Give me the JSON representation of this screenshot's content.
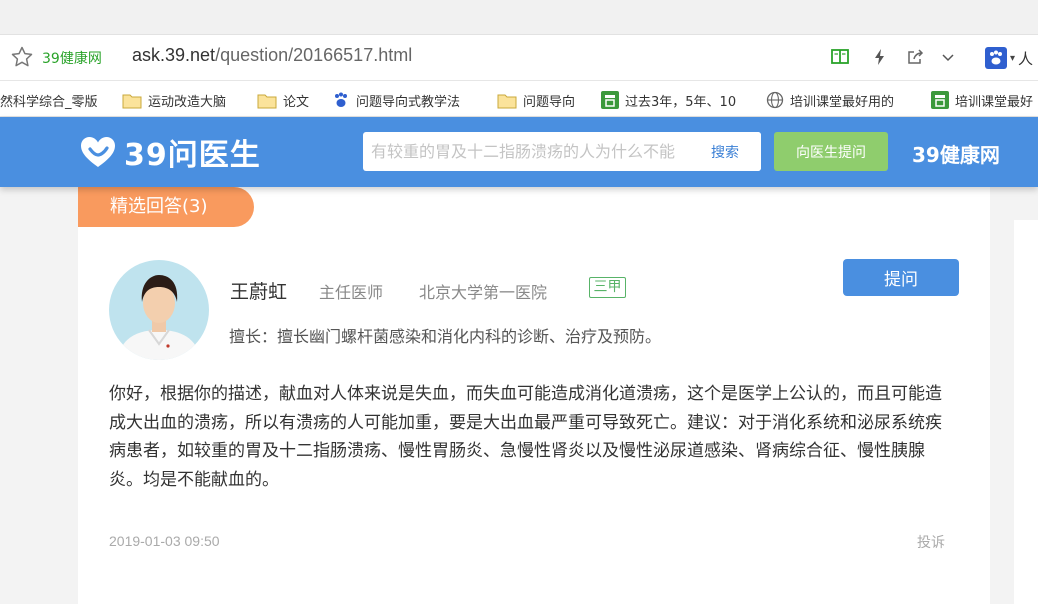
{
  "browser": {
    "site_name": "39健康网",
    "url_host": "ask.39.net",
    "url_path": "/question/20166517.html",
    "user_label": "人",
    "bookmarks": [
      {
        "label": "然科学综合_零版",
        "icon": "text-only"
      },
      {
        "label": "运动改造大脑",
        "icon": "folder-icon"
      },
      {
        "label": "论文",
        "icon": "folder-icon"
      },
      {
        "label": "问题导向式教学法",
        "icon": "paw-icon"
      },
      {
        "label": "问题导向",
        "icon": "folder-icon"
      },
      {
        "label": "过去3年，5年、10",
        "icon": "guan-icon"
      },
      {
        "label": "培训课堂最好用的",
        "icon": "globe-icon"
      },
      {
        "label": "培训课堂最好",
        "icon": "guan-icon"
      }
    ]
  },
  "header": {
    "logo_text": "39问医生",
    "search_placeholder": "有较重的胃及十二指肠溃疡的人为什么不能",
    "search_button": "搜索",
    "ask_doctor_button": "向医生提问",
    "brand": "39健康网"
  },
  "answers_tab": "精选回答(3)",
  "doctor": {
    "name": "王蔚虹",
    "title": "主任医师",
    "hospital": "北京大学第一医院",
    "grade": "三甲",
    "specialty": "擅长：擅长幽门螺杆菌感染和消化内科的诊断、治疗及预防。"
  },
  "ask_button": "提问",
  "answer_text": "你好，根据你的描述，献血对人体来说是失血，而失血可能造成消化道溃疡，这个是医学上公认的，而且可能造成大出血的溃疡，所以有溃疡的人可能加重，要是大出血最严重可导致死亡。建议：对于消化系统和泌尿系统疾病患者，如较重的胃及十二指肠溃疡、慢性胃肠炎、急慢性肾炎以及慢性泌尿道感染、肾病综合征、慢性胰腺炎。均是不能献血的。",
  "timestamp": "2019-01-03 09:50",
  "report_label": "投诉",
  "colors": {
    "header_blue": "#4a8fe0",
    "tab_orange": "#f99a5e",
    "ask_green": "#8fcd6d",
    "grade_green": "#58b368"
  }
}
